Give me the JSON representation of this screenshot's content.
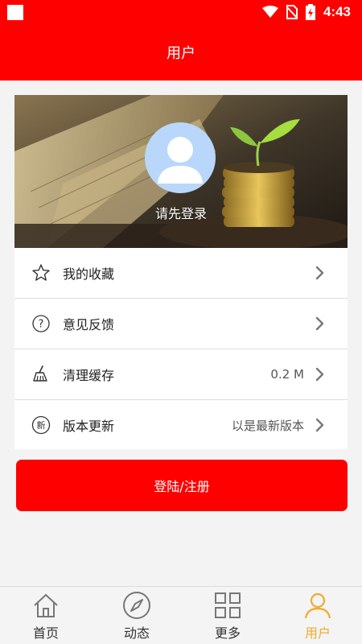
{
  "status_bar": {
    "time": "4:43"
  },
  "header": {
    "title": "用户"
  },
  "profile": {
    "login_hint": "请先登录"
  },
  "menu": {
    "items": [
      {
        "label": "我的收藏",
        "value": "",
        "icon": "star-icon"
      },
      {
        "label": "意见反馈",
        "value": "",
        "icon": "question-icon"
      },
      {
        "label": "清理缓存",
        "value": "0.2 M",
        "icon": "broom-icon"
      },
      {
        "label": "版本更新",
        "value": "以是最新版本",
        "icon": "new-badge-icon"
      }
    ]
  },
  "login_button": {
    "label": "登陆/注册"
  },
  "tabbar": {
    "tabs": [
      {
        "label": "首页",
        "icon": "home-icon"
      },
      {
        "label": "动态",
        "icon": "compass-icon"
      },
      {
        "label": "更多",
        "icon": "grid-icon"
      },
      {
        "label": "用户",
        "icon": "user-icon",
        "active": true
      }
    ]
  },
  "colors": {
    "primary": "#ff0000",
    "active_tab": "#f2a92c"
  }
}
